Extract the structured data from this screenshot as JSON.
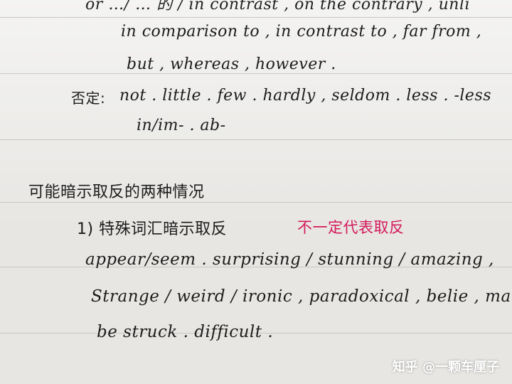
{
  "notes": {
    "line1": "or …/ … 的 / in contrast , on the contrary , unli",
    "line2": "in comparison to , in contrast to , far from ,",
    "line3": "but , whereas , however .",
    "line4_label": "否定:",
    "line4": "not . little . few . hardly , seldom . less . -less",
    "line5": "in/im- . ab-",
    "heading": "可能暗示取反的两种情况",
    "item1_label": "1) 特殊词汇暗示取反",
    "item1_note": "不一定代表取反",
    "line6": "appear/seem . surprising / stunning / amazing ,",
    "line7": "Strange / weird / ironic , paradoxical , belie , ma",
    "line8": "be struck . difficult ."
  },
  "watermark": "知乎 @一颗车厘子",
  "colors": {
    "ink": "#1c1c1c",
    "red_ink": "#d3185a",
    "paper": "#e7e6e3",
    "rule_line": "#c9c7c3"
  }
}
